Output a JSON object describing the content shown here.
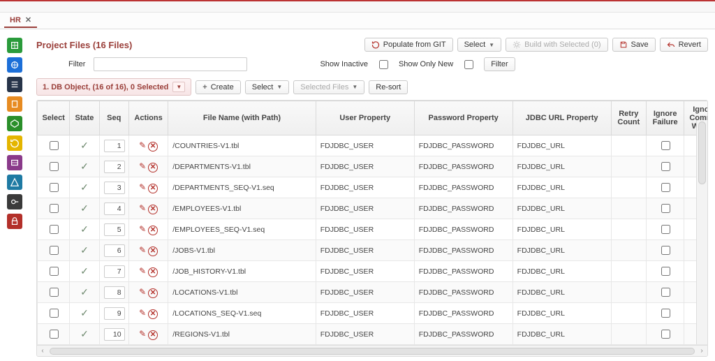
{
  "tabs": {
    "main": {
      "label": "HR"
    }
  },
  "page": {
    "title": "Project Files (16 Files)"
  },
  "header_buttons": {
    "populate_git": "Populate from GIT",
    "select": "Select",
    "build_selected": "Build with Selected (0)",
    "save": "Save",
    "revert": "Revert"
  },
  "filter": {
    "label": "Filter",
    "value": "",
    "show_inactive": "Show Inactive",
    "show_only_new": "Show Only New",
    "button": "Filter"
  },
  "toolbar": {
    "category_tab": "1. DB Object, (16 of 16), 0 Selected",
    "create": "Create",
    "select": "Select",
    "selected_files": "Selected Files",
    "resort": "Re-sort"
  },
  "columns": {
    "select": "Select",
    "state": "State",
    "seq": "Seq",
    "actions": "Actions",
    "file": "File Name (with Path)",
    "user": "User Property",
    "pass": "Password Property",
    "url": "JDBC URL Property",
    "retry": "Retry Count",
    "ignore_failure": "Ignore Failure",
    "ignore_compile": "Ignore Compila Warnin"
  },
  "rows": [
    {
      "seq": "1",
      "file": "/COUNTRIES-V1.tbl",
      "user": "FDJDBC_USER",
      "pass": "FDJDBC_PASSWORD",
      "url": "FDJDBC_URL"
    },
    {
      "seq": "2",
      "file": "/DEPARTMENTS-V1.tbl",
      "user": "FDJDBC_USER",
      "pass": "FDJDBC_PASSWORD",
      "url": "FDJDBC_URL"
    },
    {
      "seq": "3",
      "file": "/DEPARTMENTS_SEQ-V1.seq",
      "user": "FDJDBC_USER",
      "pass": "FDJDBC_PASSWORD",
      "url": "FDJDBC_URL"
    },
    {
      "seq": "4",
      "file": "/EMPLOYEES-V1.tbl",
      "user": "FDJDBC_USER",
      "pass": "FDJDBC_PASSWORD",
      "url": "FDJDBC_URL"
    },
    {
      "seq": "5",
      "file": "/EMPLOYEES_SEQ-V1.seq",
      "user": "FDJDBC_USER",
      "pass": "FDJDBC_PASSWORD",
      "url": "FDJDBC_URL"
    },
    {
      "seq": "6",
      "file": "/JOBS-V1.tbl",
      "user": "FDJDBC_USER",
      "pass": "FDJDBC_PASSWORD",
      "url": "FDJDBC_URL"
    },
    {
      "seq": "7",
      "file": "/JOB_HISTORY-V1.tbl",
      "user": "FDJDBC_USER",
      "pass": "FDJDBC_PASSWORD",
      "url": "FDJDBC_URL"
    },
    {
      "seq": "8",
      "file": "/LOCATIONS-V1.tbl",
      "user": "FDJDBC_USER",
      "pass": "FDJDBC_PASSWORD",
      "url": "FDJDBC_URL"
    },
    {
      "seq": "9",
      "file": "/LOCATIONS_SEQ-V1.seq",
      "user": "FDJDBC_USER",
      "pass": "FDJDBC_PASSWORD",
      "url": "FDJDBC_URL"
    },
    {
      "seq": "10",
      "file": "/REGIONS-V1.tbl",
      "user": "FDJDBC_USER",
      "pass": "FDJDBC_PASSWORD",
      "url": "FDJDBC_URL"
    }
  ]
}
